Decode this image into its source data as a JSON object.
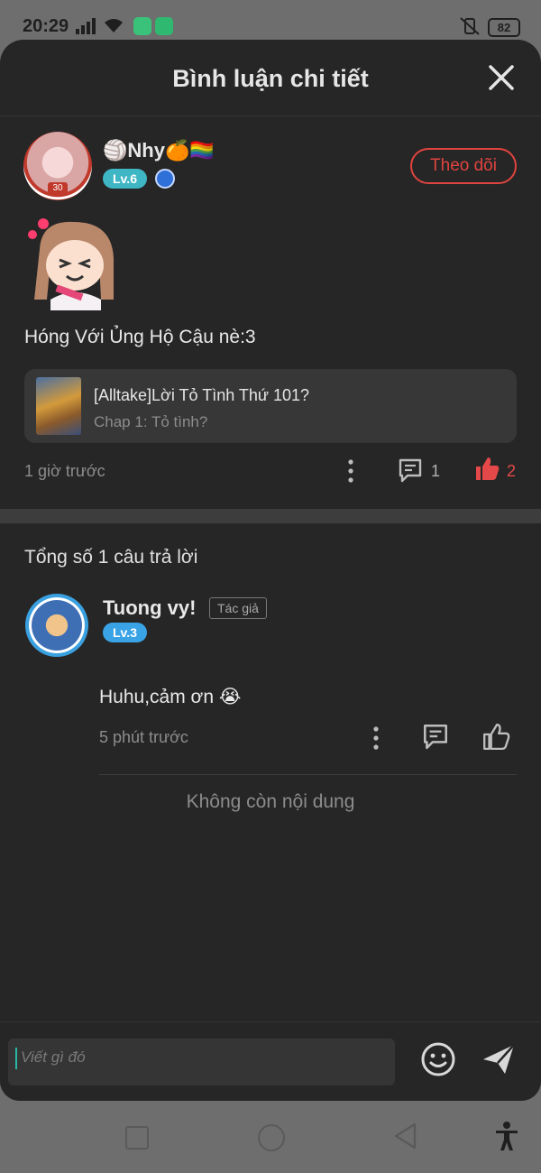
{
  "status_bar": {
    "time": "20:29",
    "battery": "82"
  },
  "header": {
    "title": "Bình luận chi tiết"
  },
  "comment": {
    "username": "🏐Nhy🍊🏳️‍🌈",
    "level": "Lv.6",
    "avatar_badge": "30",
    "follow_label": "Theo dõi",
    "text": "Hóng Với Ủng Hộ Cậu nè:3",
    "story": {
      "title": "[Alltake]Lời Tỏ Tình Thứ 101?",
      "chapter": "Chap 1: Tỏ tình?"
    },
    "time": "1 giờ trước",
    "reply_count": "1",
    "like_count": "2"
  },
  "replies": {
    "total_label": "Tổng số 1 câu trả lời",
    "items": [
      {
        "username": "Tuong vy!",
        "author_tag": "Tác giả",
        "level": "Lv.3",
        "text": "Huhu,cảm ơn 😭",
        "time": "5 phút trước"
      }
    ],
    "end_label": "Không còn nội dung"
  },
  "composer": {
    "placeholder": "Viết gì đó"
  },
  "colors": {
    "sheet_bg": "#262626",
    "accent_red": "#e0443f",
    "level6": "#3fb6c4",
    "level3": "#3aa3e6"
  }
}
